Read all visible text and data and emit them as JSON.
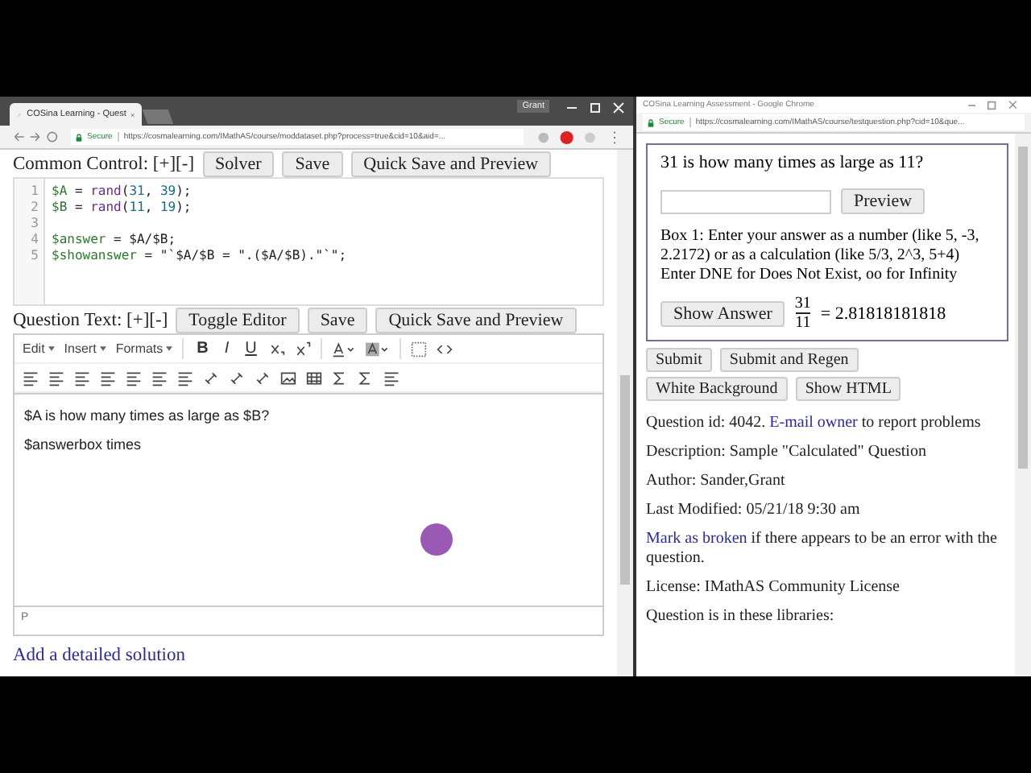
{
  "left_window": {
    "tab_title": "COSina Learning - Quest",
    "user": "Grant",
    "address": {
      "secure_label": "Secure",
      "url": "https://cosmalearning.com/IMathAS/course/moddataset.php?process=true&cid=10&aid=..."
    },
    "common_control": {
      "label": "Common Control: [+][-]",
      "buttons": [
        "Solver",
        "Save",
        "Quick Save and Preview"
      ]
    },
    "code_lines": [
      {
        "number": "1",
        "tokens": [
          {
            "text": "$A",
            "kind": "var"
          },
          {
            "text": " = ",
            "kind": "plain"
          },
          {
            "text": "rand",
            "kind": "func"
          },
          {
            "text": "(",
            "kind": "plain"
          },
          {
            "text": "31",
            "kind": "num"
          },
          {
            "text": ", ",
            "kind": "plain"
          },
          {
            "text": "39",
            "kind": "num"
          },
          {
            "text": ");",
            "kind": "plain"
          }
        ]
      },
      {
        "number": "2",
        "tokens": [
          {
            "text": "$B",
            "kind": "var"
          },
          {
            "text": " = ",
            "kind": "plain"
          },
          {
            "text": "rand",
            "kind": "func"
          },
          {
            "text": "(",
            "kind": "plain"
          },
          {
            "text": "11",
            "kind": "num"
          },
          {
            "text": ", ",
            "kind": "plain"
          },
          {
            "text": "19",
            "kind": "num"
          },
          {
            "text": ");",
            "kind": "plain"
          }
        ]
      },
      {
        "number": "3"
      },
      {
        "number": "4",
        "tokens": [
          {
            "text": "$answer",
            "kind": "var"
          },
          {
            "text": " = $A/$B;",
            "kind": "plain"
          }
        ]
      },
      {
        "number": "5",
        "tokens": [
          {
            "text": "$showanswer",
            "kind": "var"
          },
          {
            "text": " = \"`$A/$B = \".($A/$B).\"`\";",
            "kind": "plain"
          }
        ]
      }
    ],
    "question_text": {
      "label": "Question Text: [+][-]",
      "buttons": [
        "Toggle Editor",
        "Save",
        "Quick Save and Preview"
      ]
    },
    "editor": {
      "menus": [
        "Edit",
        "Insert",
        "Formats"
      ],
      "format_glyphs": [
        "B",
        "I",
        "U"
      ],
      "paragraphs": [
        "$A is how many times as large as $B?",
        "$answerbox times"
      ],
      "status_path": "P"
    },
    "solution_link": "Add a detailed solution"
  },
  "right_window": {
    "title": "COSina Learning Assessment - Google Chrome",
    "address": {
      "secure_label": "Secure",
      "url": "https://cosmalearning.com/IMathAS/course/testquestion.php?cid=10&que..."
    },
    "question": "31 is how many times as large as 11?",
    "preview_button": "Preview",
    "hint_lines": [
      "Box 1: Enter your answer as a number (like 5, -3, 2.2172) or as a calculation (like 5/3, 2^3, 5+4)",
      "Enter DNE for Does Not Exist, oo for Infinity"
    ],
    "show_answer_button": "Show Answer",
    "answer": {
      "numerator": "31",
      "denominator": "11",
      "result": "= 2.81818181818"
    },
    "buttons": [
      "Submit",
      "Submit and Regen",
      "White Background",
      "Show HTML"
    ],
    "info": [
      {
        "kind": "link_first",
        "link": "E-mail owner",
        "before": "Question id: 4042. ",
        "after": " to report problems"
      },
      {
        "kind": "plain",
        "text": "Description: Sample \"Calculated\" Question"
      },
      {
        "kind": "plain",
        "text": "Author: Sander,Grant"
      },
      {
        "kind": "plain",
        "text": "Last Modified: 05/21/18 9:30 am"
      },
      {
        "kind": "link_first",
        "link": "Mark as broken",
        "after": " if there appears to be an error with the question."
      },
      {
        "kind": "plain",
        "text": "License: IMathAS Community License"
      },
      {
        "kind": "plain",
        "text": "Question is in these libraries:"
      }
    ]
  }
}
